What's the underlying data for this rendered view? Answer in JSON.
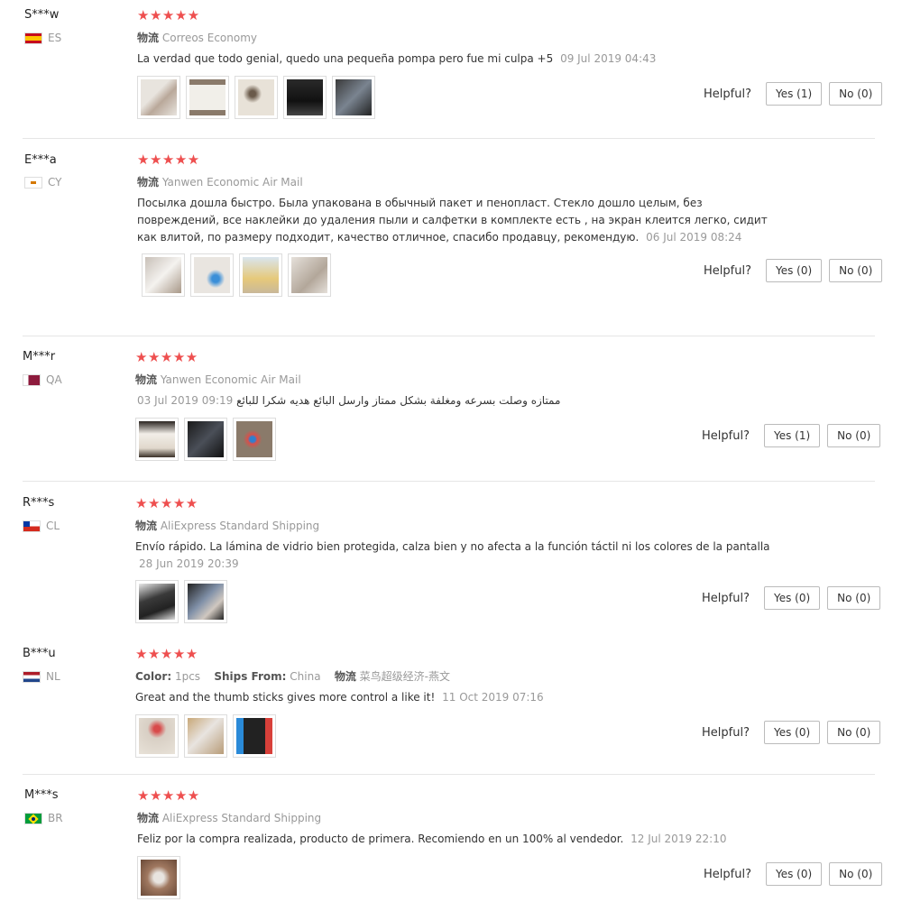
{
  "ui": {
    "helpful_label": "Helpful?",
    "logistics_label": "物流"
  },
  "reviews": [
    {
      "name": "S***w",
      "country": "ES",
      "stars": "★★★★★",
      "shipping": "Correos Economy",
      "text": "La verdad que todo genial, quedo una pequeña pompa pero fue mi culpa +5",
      "date": "09 Jul 2019 04:43",
      "yes": "Yes (1)",
      "no": "No (0)"
    },
    {
      "name": "E***a",
      "country": "CY",
      "stars": "★★★★★",
      "shipping": "Yanwen Economic Air Mail",
      "text": "Посылка дошла быстро. Была упакована в обычный пакет и пенопласт. Стекло дошло целым, без повреждений, все наклейки до удаления пыли и салфетки в комплекте есть , на экран клеится легко, сидит как влитой, по размеру подходит, качество отличное, спасибо продавцу, рекомендую.",
      "date": "06 Jul 2019 08:24",
      "yes": "Yes (0)",
      "no": "No (0)"
    },
    {
      "name": "M***r",
      "country": "QA",
      "stars": "★★★★★",
      "shipping": "Yanwen Economic Air Mail",
      "text": "ممتازه وصلت بسرعه ومغلفة بشكل ممتاز وارسل البائع هديه شكرا للبائع",
      "date": "03 Jul 2019 09:19",
      "yes": "Yes (1)",
      "no": "No (0)"
    },
    {
      "name": "R***s",
      "country": "CL",
      "stars": "★★★★★",
      "shipping": "AliExpress Standard Shipping",
      "text": "Envío rápido. La lámina de vidrio bien protegida, calza bien y no afecta a la función táctil ni los colores de la pantalla",
      "date": "28 Jun 2019 20:39",
      "yes": "Yes (0)",
      "no": "No (0)"
    },
    {
      "name": "B***u",
      "country": "NL",
      "stars": "★★★★★",
      "color_label": "Color:",
      "color_value": "1pcs",
      "ships_label": "Ships From:",
      "ships_value": "China",
      "shipping": "菜鸟超级经济-燕文",
      "text": "Great and the thumb sticks gives more control a like it!",
      "date": "11 Oct 2019 07:16",
      "yes": "Yes (0)",
      "no": "No (0)"
    },
    {
      "name": "M***s",
      "country": "BR",
      "stars": "★★★★★",
      "shipping": "AliExpress Standard Shipping",
      "text": "Feliz por la compra realizada, producto de primera. Recomiendo en un 100% al vendedor.",
      "date": "12 Jul 2019 22:10",
      "yes": "Yes (0)",
      "no": "No (0)"
    }
  ],
  "colors": {
    "star": "#ee4f4f",
    "muted": "#999999"
  }
}
